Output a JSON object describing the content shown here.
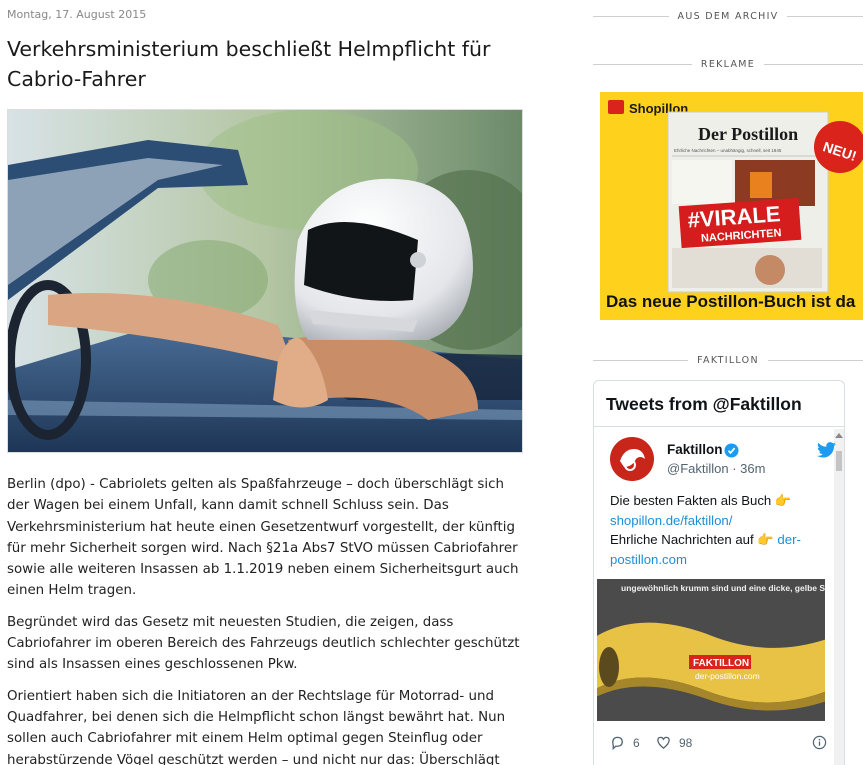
{
  "article": {
    "date": "Montag, 17. August 2015",
    "title": "Verkehrsministerium beschließt Helmpflicht für Cabrio-Fahrer",
    "paragraphs": [
      "Berlin (dpo) - Cabriolets gelten als Spaßfahrzeuge – doch überschlägt sich der Wagen bei einem Unfall, kann damit schnell Schluss sein. Das Verkehrsministerium hat heute einen Gesetzentwurf vorgestellt, der künftig für mehr Sicherheit sorgen wird. Nach §21a Abs7 StVO müssen Cabriofahrer sowie alle weiteren Insassen ab 1.1.2019 neben einem Sicherheitsgurt auch einen Helm tragen.",
      "Begründet wird das Gesetz mit neuesten Studien, die zeigen, dass Cabriofahrer im oberen Bereich des Fahrzeugs deutlich schlechter geschützt sind als Insassen eines geschlossenen Pkw.",
      "Orientiert haben sich die Initiatoren an der Rechtslage für Motorrad- und Quadfahrer, bei denen sich die Helmpflicht schon längst bewährt hat. Nun sollen auch Cabriofahrer mit einem Helm optimal gegen Steinflug oder herabstürzende Vögel geschützt werden – und nicht nur das: Überschlägt sich das Fahrzeug, können die Insassen sicher auf ihrem Helm abrollen."
    ]
  },
  "sidebar": {
    "archive_heading": "AUS DEM ARCHIV",
    "ad_heading": "REKLAME",
    "faktillon_heading": "FAKTILLON",
    "ad": {
      "shop_logo": "Shopillon",
      "book_title": "Der Postillon",
      "book_tagline": "Ehrliche Nachrichten – unabhängig, schnell, seit 1845",
      "virale_top": "#VIRALE",
      "virale_bottom": "NACHRICHTEN",
      "badge": "NEU!",
      "banner": "Das neue Postillon-Buch ist da"
    },
    "twitter": {
      "header": "Tweets from @Faktillon",
      "name": "Faktillon",
      "handle": "@Faktillon · 36m",
      "text_1": "Die besten Fakten als Buch 👉",
      "link_1": "shopillon.de/faktillon/",
      "text_2": "Ehrliche Nachrichten auf 👉 ",
      "link_2": "der-postillon.com",
      "media_text": "ungewöhnlich krumm sind und eine dicke, gelbe Schale haben.",
      "media_brand": "FAKTILLON",
      "media_site": "der-postillon.com",
      "replies": "6",
      "likes": "98"
    }
  }
}
